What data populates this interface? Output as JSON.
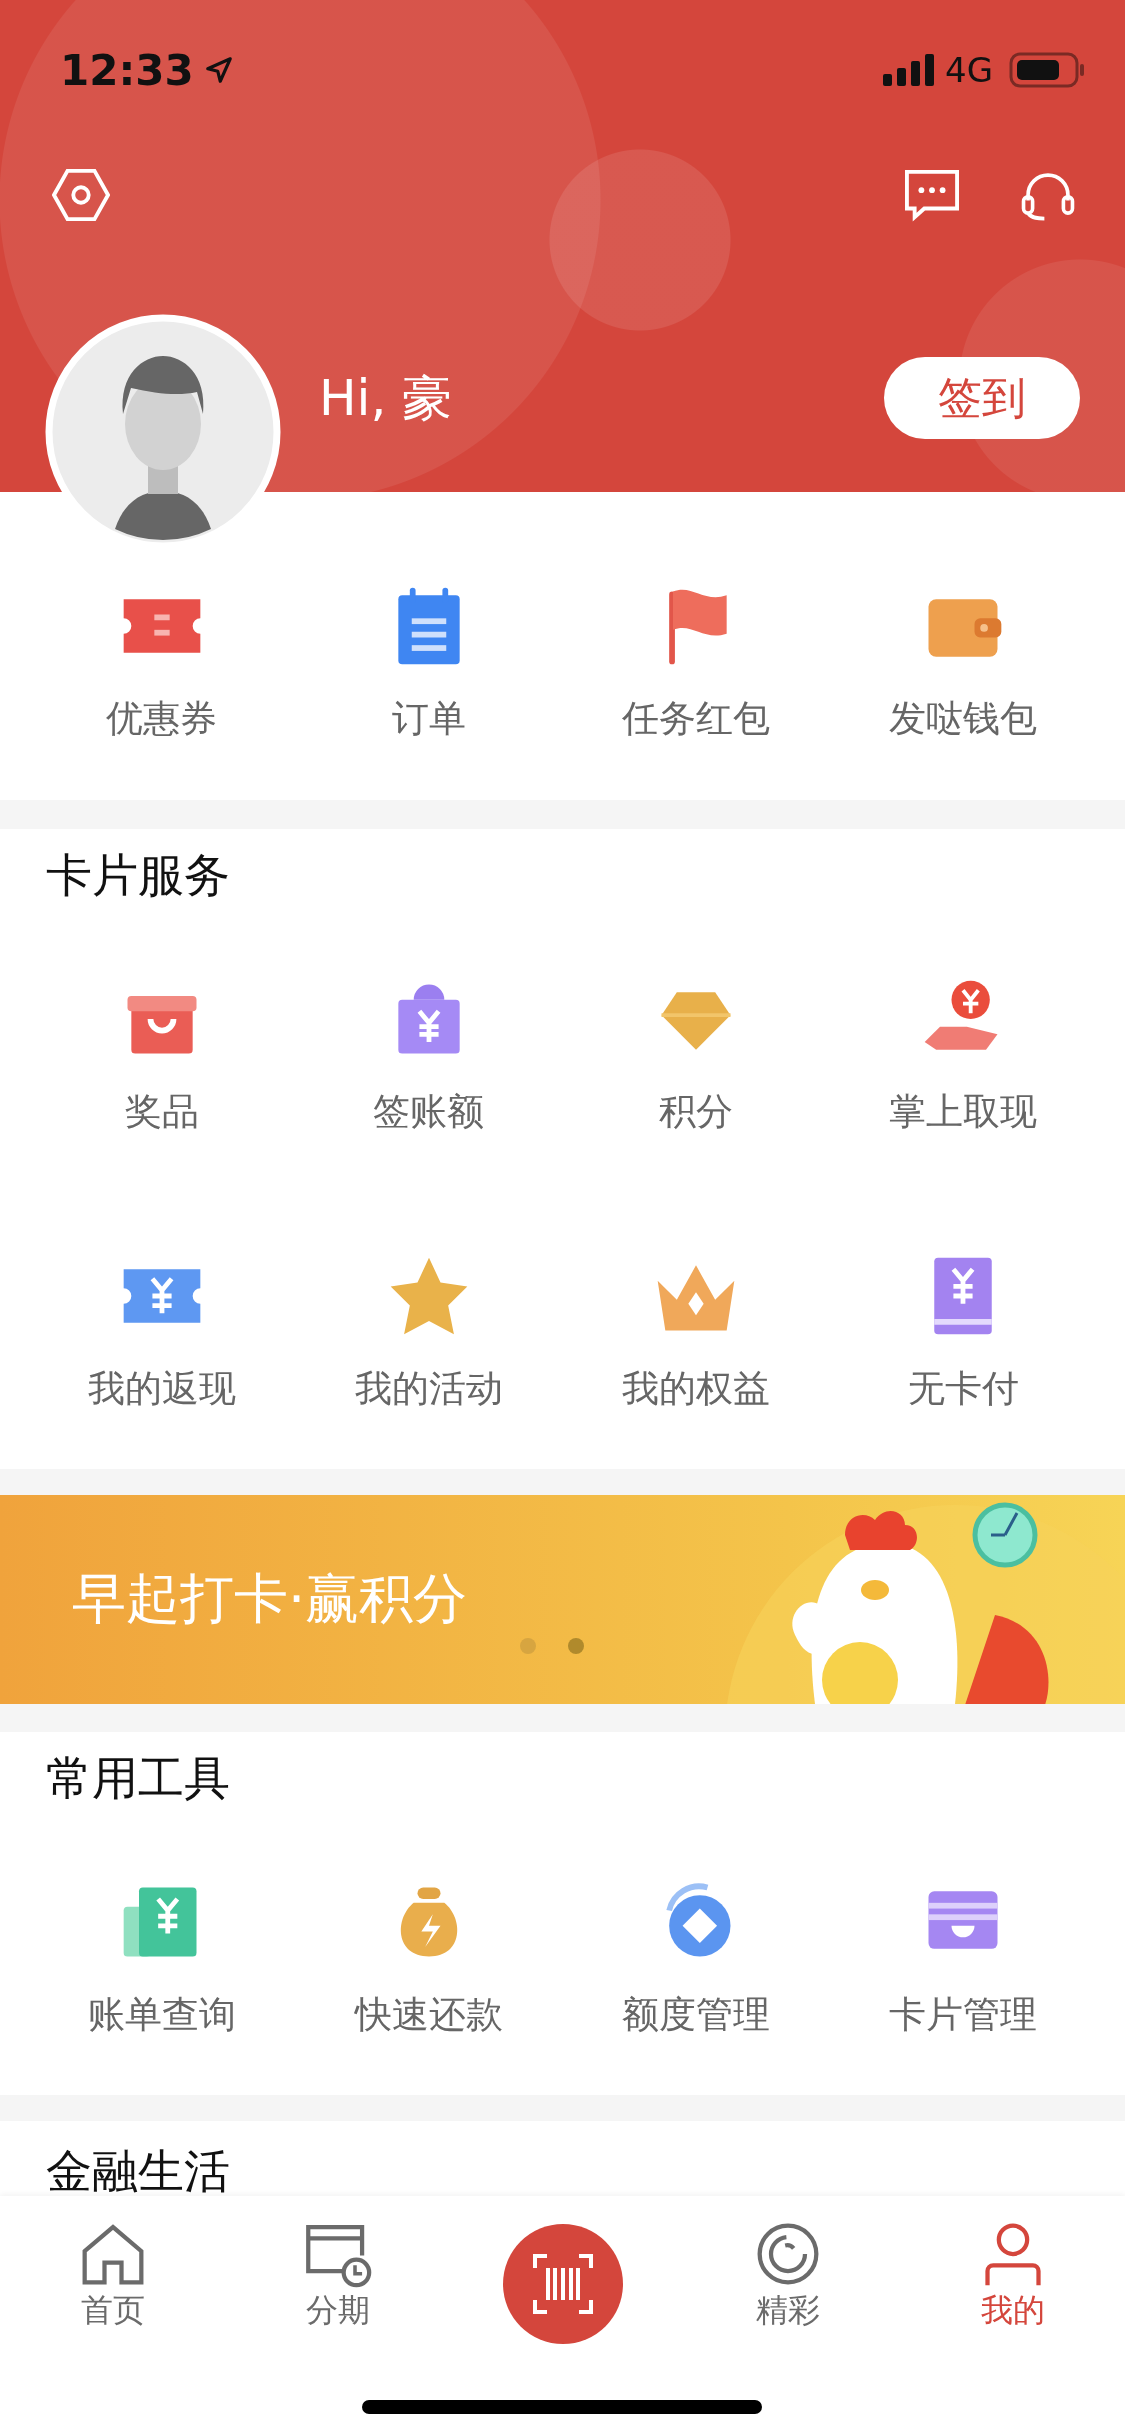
{
  "status_bar": {
    "time": "12:33",
    "network": "4G"
  },
  "header": {
    "greeting": "Hi, 豪",
    "sign_in_button": "签到"
  },
  "quick_links": [
    {
      "label": "优惠券"
    },
    {
      "label": "订单"
    },
    {
      "label": "任务红包"
    },
    {
      "label": "发哒钱包"
    }
  ],
  "card_services": {
    "title": "卡片服务",
    "items": [
      {
        "label": "奖品"
      },
      {
        "label": "签账额"
      },
      {
        "label": "积分"
      },
      {
        "label": "掌上取现"
      },
      {
        "label": "我的返现"
      },
      {
        "label": "我的活动"
      },
      {
        "label": "我的权益"
      },
      {
        "label": "无卡付"
      }
    ]
  },
  "banner": {
    "title": "早起打卡·赢积分",
    "dots": [
      {
        "selected": false
      },
      {
        "selected": true
      }
    ]
  },
  "tools": {
    "title": "常用工具",
    "items": [
      {
        "label": "账单查询"
      },
      {
        "label": "快速还款"
      },
      {
        "label": "额度管理"
      },
      {
        "label": "卡片管理"
      }
    ]
  },
  "next_section": {
    "title": "金融生活"
  },
  "bottom_nav": [
    {
      "kind": "tab",
      "label": "首页",
      "selected": false
    },
    {
      "kind": "tab",
      "label": "分期",
      "selected": false
    },
    {
      "kind": "scan"
    },
    {
      "kind": "tab",
      "label": "精彩",
      "selected": false
    },
    {
      "kind": "tab",
      "label": "我的",
      "selected": true
    }
  ]
}
